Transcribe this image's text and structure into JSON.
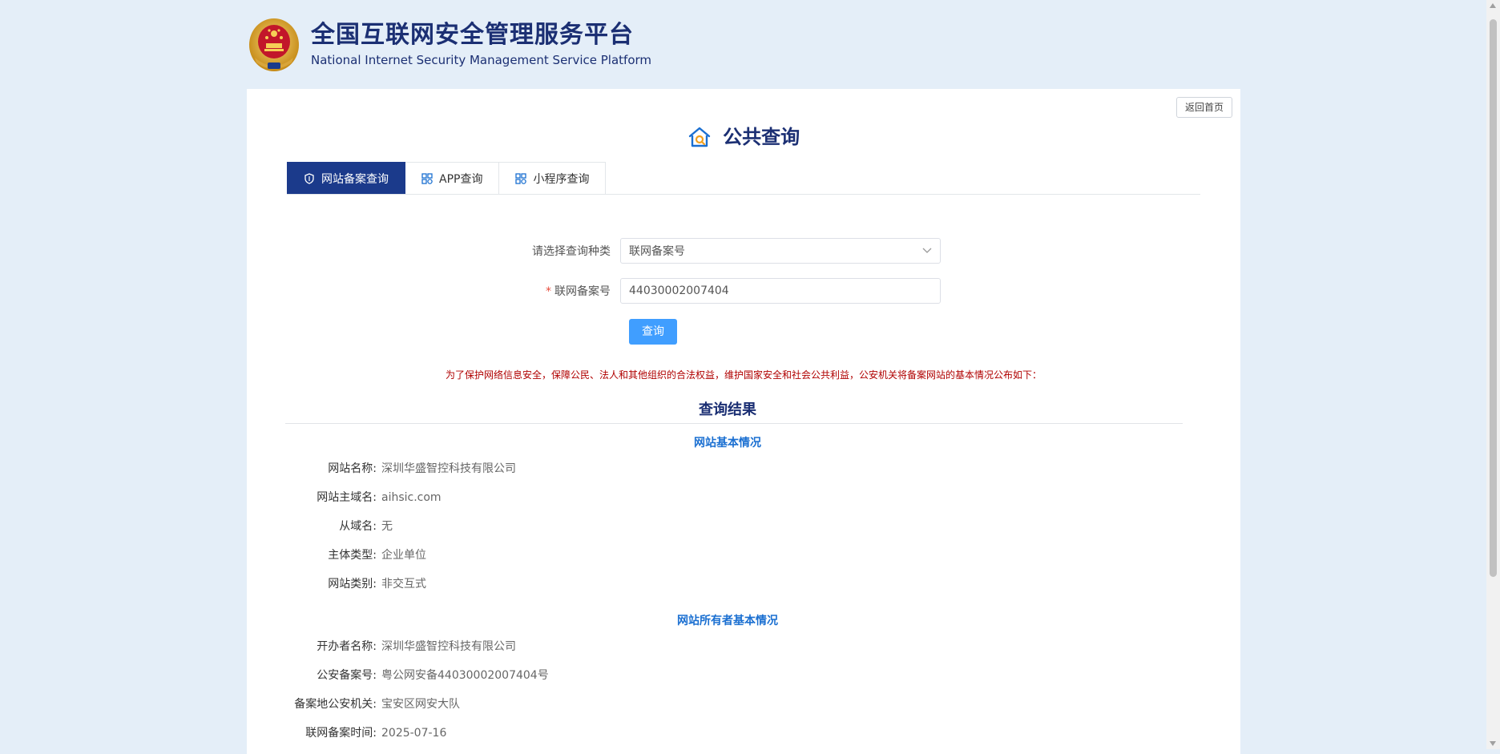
{
  "header": {
    "title_cn": "全国互联网安全管理服务平台",
    "title_en": "National Internet Security Management Service Platform",
    "emblem_icon": "police-emblem-icon"
  },
  "card": {
    "home_button": "返回首页",
    "page_title": "公共查询",
    "page_title_icon": "house-search-icon"
  },
  "tabs": [
    {
      "label": "网站备案查询",
      "icon": "shield-icon",
      "active": true
    },
    {
      "label": "APP查询",
      "icon": "apps-grid-icon",
      "active": false
    },
    {
      "label": "小程序查询",
      "icon": "apps-grid-icon",
      "active": false
    }
  ],
  "form": {
    "query_type_label": "请选择查询种类",
    "query_type_value": "联网备案号",
    "record_label": "联网备案号",
    "record_required_mark": "*",
    "record_value": "44030002007404",
    "submit_label": "查询"
  },
  "notice": "为了保护网络信息安全，保障公民、法人和其他组织的合法权益，维护国家安全和社会公共利益，公安机关将备案网站的基本情况公布如下：",
  "result": {
    "title": "查询结果",
    "site_section_title": "网站基本情况",
    "site_info": [
      {
        "label": "网站名称:",
        "value": "深圳华盛智控科技有限公司"
      },
      {
        "label": "网站主域名:",
        "value": "aihsic.com"
      },
      {
        "label": "从域名:",
        "value": "无"
      },
      {
        "label": "主体类型:",
        "value": "企业单位"
      },
      {
        "label": "网站类别:",
        "value": "非交互式"
      }
    ],
    "owner_section_title": "网站所有者基本情况",
    "owner_info": [
      {
        "label": "开办者名称:",
        "value": "深圳华盛智控科技有限公司"
      },
      {
        "label": "公安备案号:",
        "value": "粤公网安备44030002007404号"
      },
      {
        "label": "备案地公安机关:",
        "value": "宝安区网安大队"
      },
      {
        "label": "联网备案时间:",
        "value": "2025-07-16"
      }
    ]
  },
  "colors": {
    "brand_navy": "#1b2f73",
    "tab_active_bg": "#1b3a8b",
    "button_blue": "#409eff",
    "section_blue": "#1a6fd1",
    "notice_red": "#b00000",
    "page_bg": "#e4eef8"
  }
}
